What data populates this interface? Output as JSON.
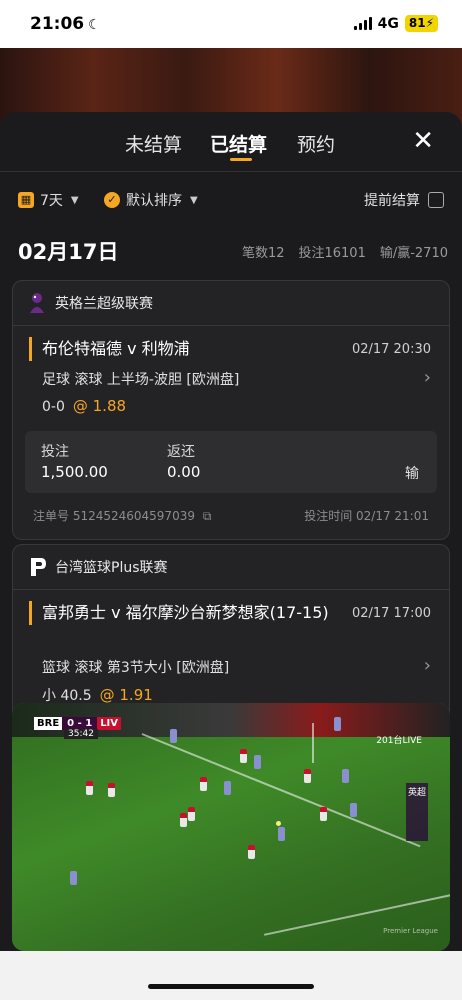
{
  "status_bar": {
    "time": "21:06",
    "network": "4G",
    "battery": "81"
  },
  "tabs": [
    {
      "label": "未结算",
      "active": false
    },
    {
      "label": "已结算",
      "active": true
    },
    {
      "label": "预约",
      "active": false
    }
  ],
  "filters": {
    "period": "7天",
    "sort": "默认排序",
    "early_settle": "提前结算",
    "early_settle_checked": false
  },
  "day": {
    "date": "02月17日",
    "count": "笔数12",
    "stake": "投注16101",
    "result": "输/赢-2710"
  },
  "bets": [
    {
      "league": "英格兰超级联赛",
      "match": "布伦特福德 v 利物浦",
      "time": "02/17 20:30",
      "detail": "足球  滚球   上半场-波胆  [欧洲盘]",
      "selection": "0-0",
      "odds": "@ 1.88",
      "stake_label": "投注",
      "stake": "1,500.00",
      "return_label": "返还",
      "return": "0.00",
      "result": "输",
      "ticket": "注单号 5124524604597039",
      "bet_time": "投注时间 02/17 21:01"
    },
    {
      "league": "台湾篮球Plus联赛",
      "match": "富邦勇士 v 福尔摩沙台新梦想家(17-15)",
      "time": "02/17 17:00",
      "detail": "篮球  滚球   第3节大小  [欧洲盘]",
      "selection": "小 40.5",
      "odds": "@ 1.91"
    }
  ],
  "video": {
    "home": "BRE",
    "score": "0 - 1",
    "away": "LIV",
    "clock": "35:42",
    "channel": "201台LIVE",
    "badge": "英超",
    "watermark": "Premier League"
  },
  "colors": {
    "accent": "#f5a623",
    "sheet_bg": "#1b1b1d",
    "card_bg": "#232325"
  }
}
